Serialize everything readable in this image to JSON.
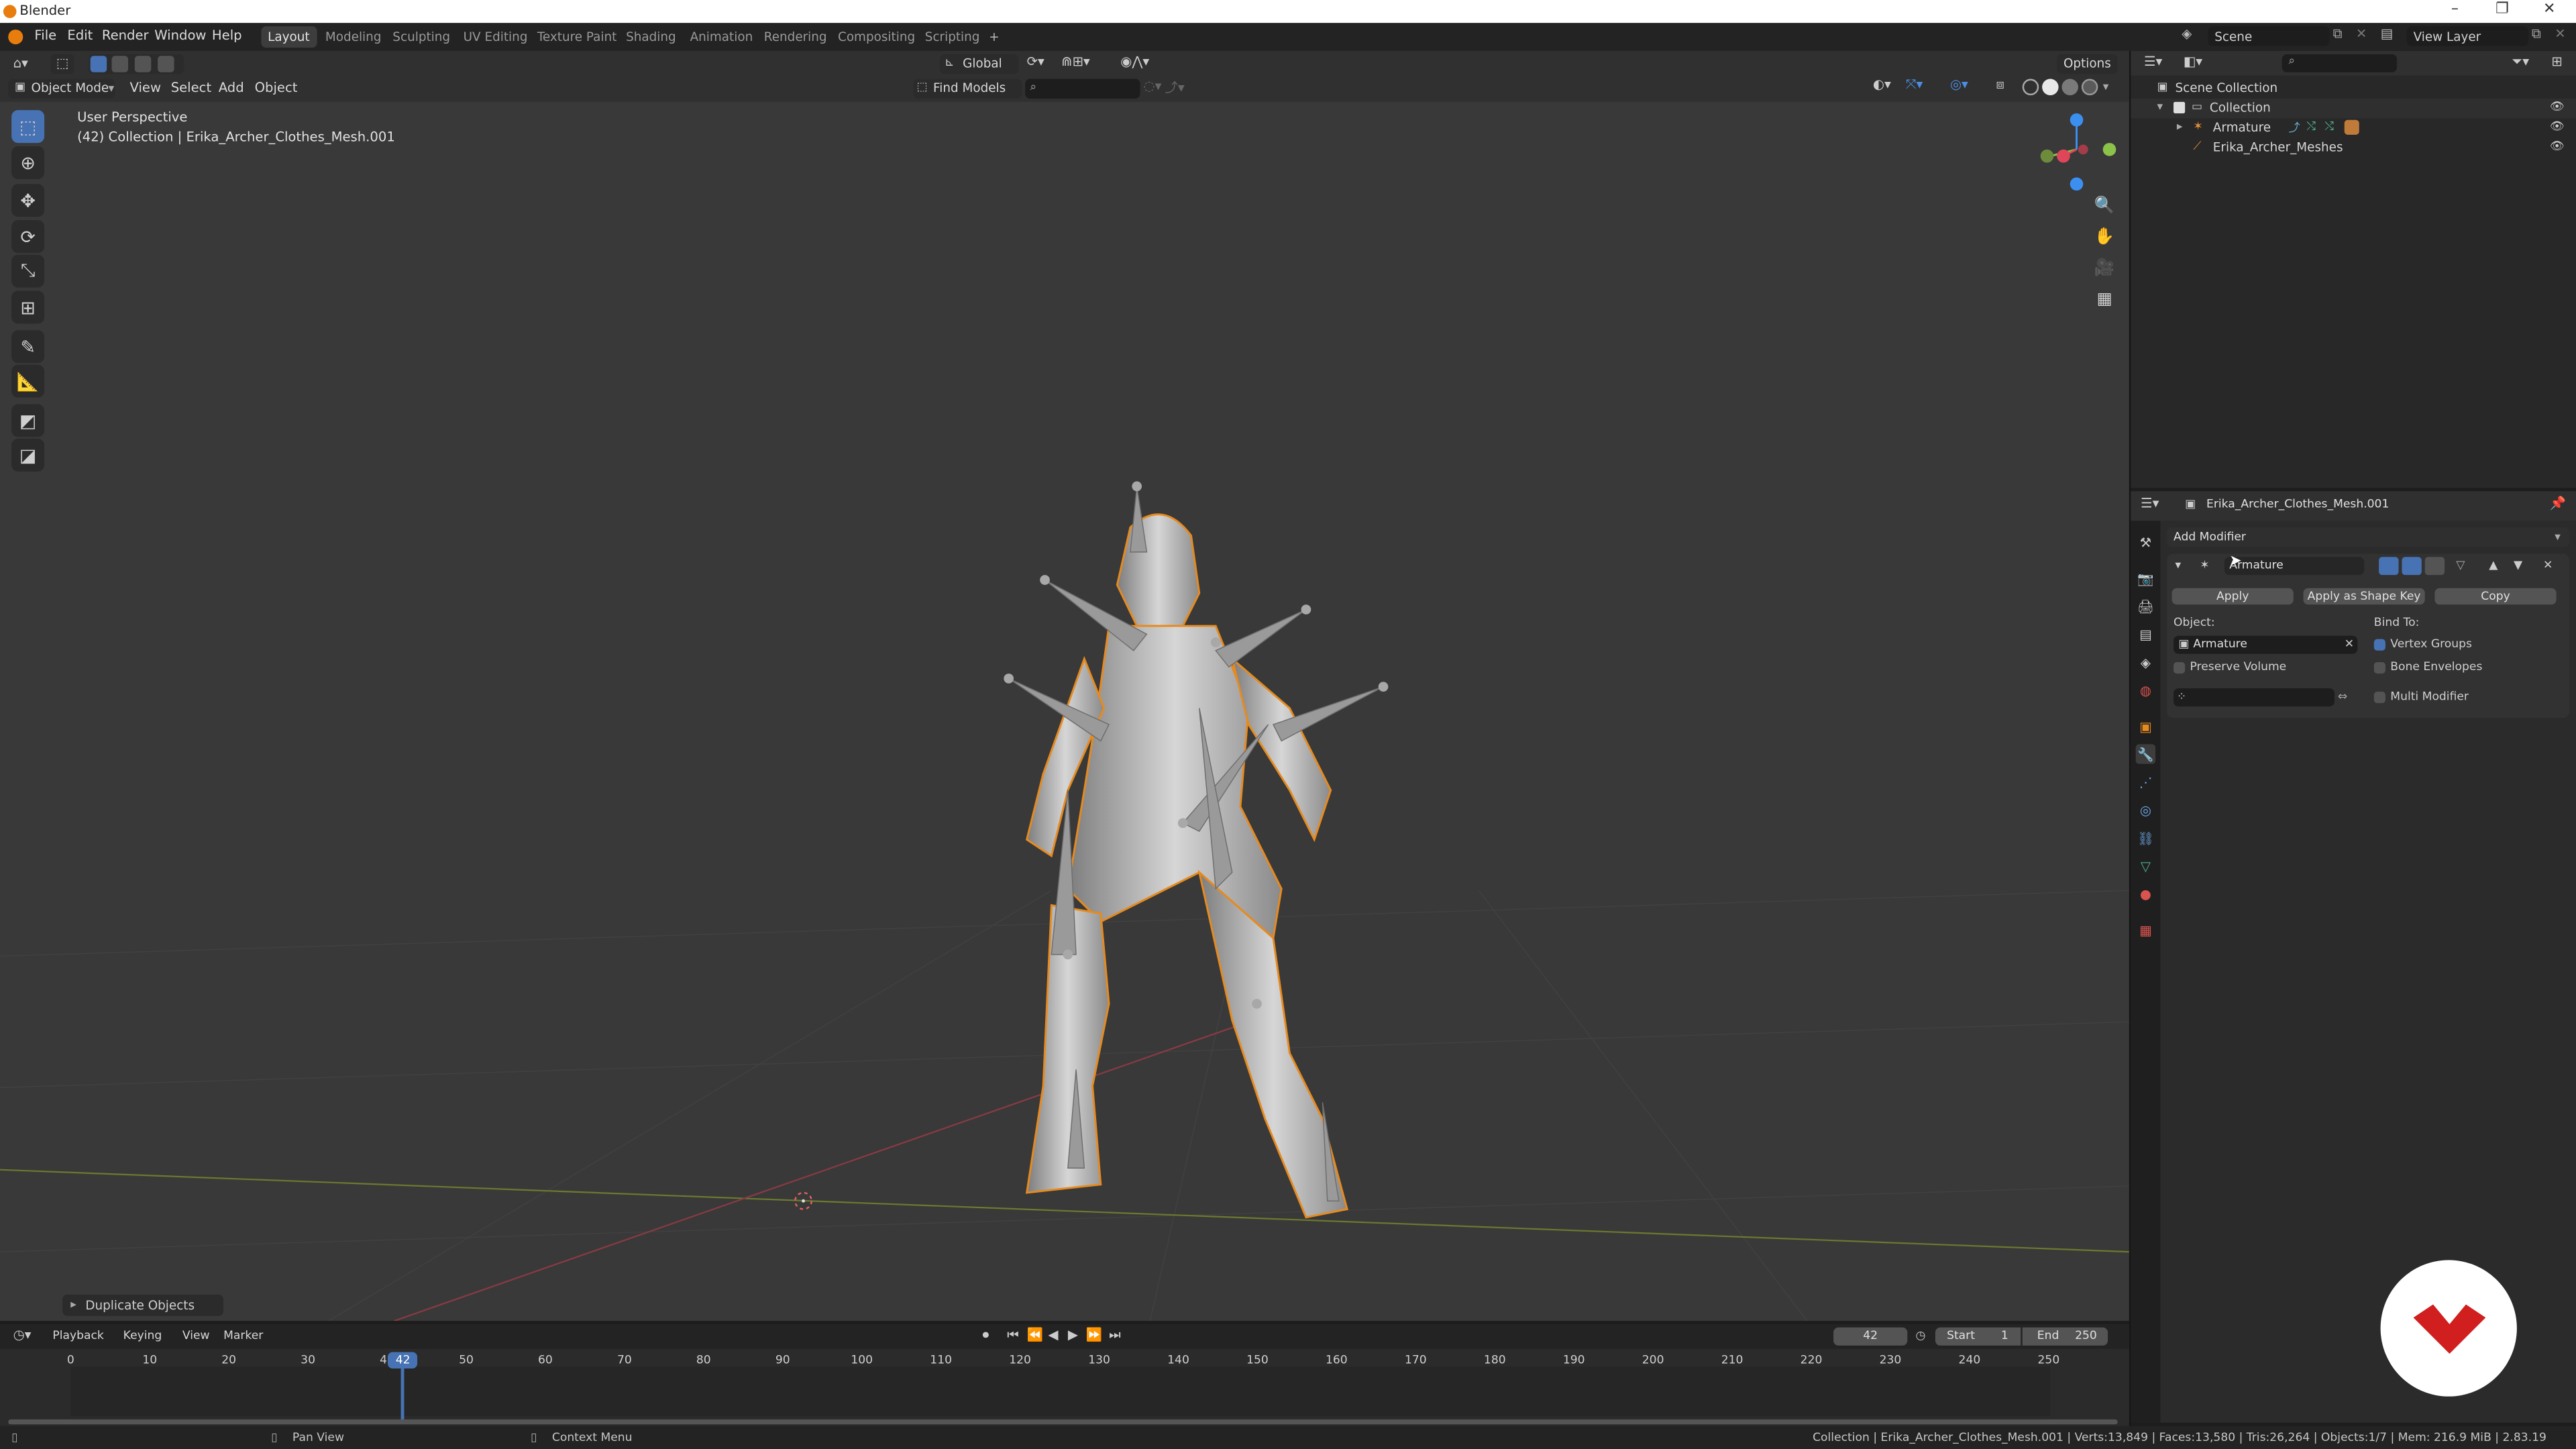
{
  "window": {
    "title": "Blender",
    "controls": [
      "–",
      "❐",
      "✕"
    ]
  },
  "menus": [
    "File",
    "Edit",
    "Render",
    "Window",
    "Help"
  ],
  "workspaces": [
    {
      "label": "Layout",
      "active": true
    },
    {
      "label": "Modeling",
      "active": false
    },
    {
      "label": "Sculpting",
      "active": false
    },
    {
      "label": "UV Editing",
      "active": false
    },
    {
      "label": "Texture Paint",
      "active": false
    },
    {
      "label": "Shading",
      "active": false
    },
    {
      "label": "Animation",
      "active": false
    },
    {
      "label": "Rendering",
      "active": false
    },
    {
      "label": "Compositing",
      "active": false
    },
    {
      "label": "Scripting",
      "active": false
    }
  ],
  "add_workspace": "+",
  "scene": {
    "name": "Scene",
    "view_layer": "View Layer"
  },
  "viewport": {
    "mode": "Object Mode",
    "menus": [
      "View",
      "Select",
      "Add",
      "Object"
    ],
    "transform_orientation": "Global",
    "find_models": "Find Models",
    "options": "Options",
    "perspective_label": "User Perspective",
    "collection_label": "(42) Collection | Erika_Archer_Clothes_Mesh.001",
    "last_operator": "Duplicate Objects",
    "axes": {
      "x": "X",
      "y": "Y",
      "z": "Z"
    },
    "colors": {
      "x_axis": "#e0465a",
      "y_axis": "#8bc34a",
      "z_axis": "#3b8ff0",
      "selection_outline": "#e68a1f",
      "active_tool": "#4772b3"
    }
  },
  "tools": [
    "select-box-icon",
    "cursor-icon",
    "move-icon",
    "rotate-icon",
    "scale-icon",
    "transform-icon",
    "annotate-icon",
    "measure-icon",
    "add-cube-icon",
    "extrude-icon"
  ],
  "outliner": {
    "items": [
      {
        "label": "Scene Collection",
        "icon": "scene-collection-icon",
        "indent": 0
      },
      {
        "label": "Collection",
        "icon": "collection-icon",
        "indent": 1
      },
      {
        "label": "Armature",
        "icon": "armature-icon",
        "indent": 2
      },
      {
        "label": "Erika_Archer_Meshes",
        "icon": "bone-icon",
        "indent": 2
      }
    ]
  },
  "properties": {
    "object_name": "Erika_Archer_Clothes_Mesh.001",
    "add_modifier": "Add Modifier",
    "modifier": {
      "name": "Armature",
      "apply": "Apply",
      "apply_shape_key": "Apply as Shape Key",
      "copy": "Copy",
      "object_label": "Object:",
      "object_value": "Armature",
      "bind_to_label": "Bind To:",
      "vertex_groups": "Vertex Groups",
      "vertex_groups_checked": true,
      "preserve_volume": "Preserve Volume",
      "preserve_volume_checked": false,
      "bone_envelopes": "Bone Envelopes",
      "bone_envelopes_checked": false,
      "multi_modifier": "Multi Modifier",
      "multi_modifier_checked": false
    }
  },
  "timeline": {
    "menus": [
      "Playback",
      "Keying",
      "View",
      "Marker"
    ],
    "current_frame": "42",
    "start_label": "Start",
    "start_value": "1",
    "end_label": "End",
    "end_value": "250",
    "ticks": [
      "0",
      "10",
      "20",
      "30",
      "40",
      "50",
      "60",
      "70",
      "80",
      "90",
      "100",
      "110",
      "120",
      "130",
      "140",
      "150",
      "160",
      "170",
      "180",
      "190",
      "200",
      "210",
      "220",
      "230",
      "240",
      "250"
    ],
    "frame_value": 42,
    "frame_start": 1,
    "frame_end": 250
  },
  "status": {
    "pan_view": "Pan View",
    "context_menu": "Context Menu",
    "info": "Collection | Erika_Archer_Clothes_Mesh.001 | Verts:13,849 | Faces:13,580 | Tris:26,264 | Objects:1/7 | Mem: 216.9 MiB | 2.83.19"
  }
}
